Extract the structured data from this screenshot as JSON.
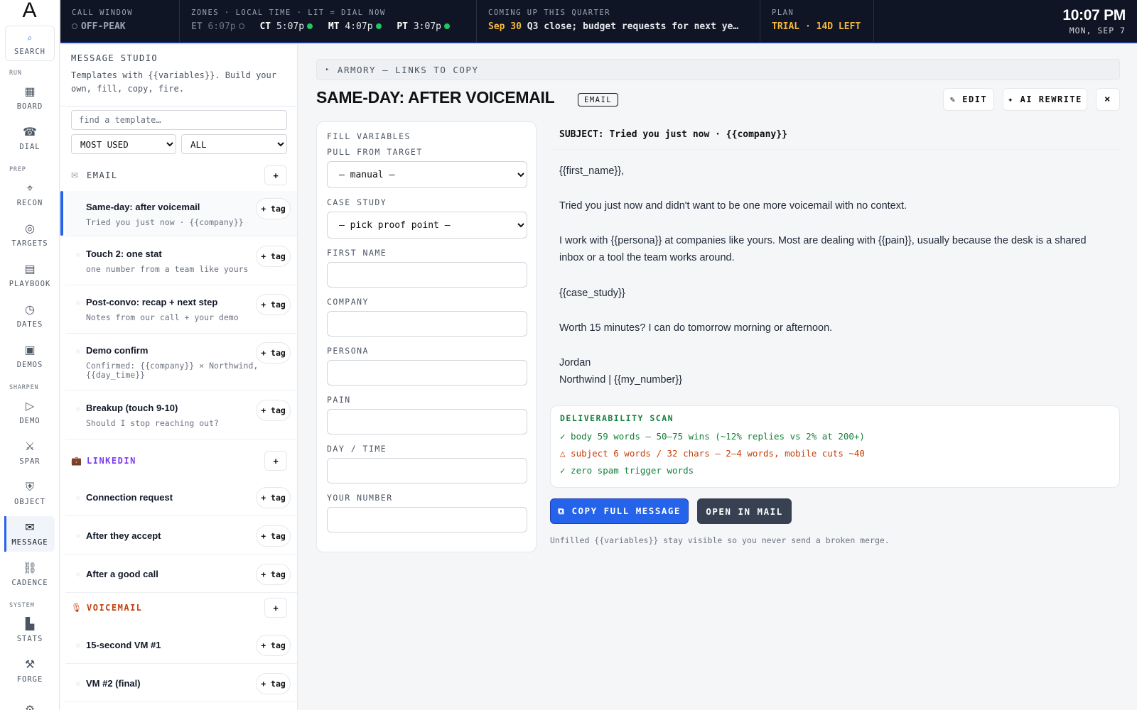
{
  "rail": {
    "logo": "A",
    "search": {
      "icon": "⌕",
      "label": "SEARCH"
    },
    "sections": {
      "run": "RUN",
      "prep": "PREP",
      "sharpen": "SHARPEN",
      "system": "SYSTEM"
    },
    "items": [
      {
        "icon": "▦",
        "label": "BOARD"
      },
      {
        "icon": "☎",
        "label": "DIAL"
      },
      {
        "icon": "⌖",
        "label": "RECON"
      },
      {
        "icon": "◎",
        "label": "TARGETS"
      },
      {
        "icon": "▤",
        "label": "PLAYBOOK"
      },
      {
        "icon": "◷",
        "label": "DATES"
      },
      {
        "icon": "▣",
        "label": "DEMOS"
      },
      {
        "icon": "▷",
        "label": "DEMO"
      },
      {
        "icon": "⚔",
        "label": "SPAR"
      },
      {
        "icon": "⛨",
        "label": "OBJECT"
      },
      {
        "icon": "✉",
        "label": "MESSAGE"
      },
      {
        "icon": "⛓",
        "label": "CADENCE"
      },
      {
        "icon": "▙",
        "label": "STATS"
      },
      {
        "icon": "⚒",
        "label": "FORGE"
      },
      {
        "icon": "⚙",
        "label": ""
      }
    ]
  },
  "topbar": {
    "call_window": {
      "label": "CALL WINDOW",
      "value": "OFF-PEAK"
    },
    "zones": {
      "label": "ZONES · LOCAL TIME · LIT = DIAL NOW",
      "items": [
        {
          "zone": "ET",
          "time": "6:07p",
          "lit": false
        },
        {
          "zone": "CT",
          "time": "5:07p",
          "lit": true
        },
        {
          "zone": "MT",
          "time": "4:07p",
          "lit": true
        },
        {
          "zone": "PT",
          "time": "3:07p",
          "lit": true
        }
      ]
    },
    "quarter": {
      "label": "COMING UP THIS QUARTER",
      "date": "Sep 30",
      "text": "Q3 close; budget requests for next ye…"
    },
    "plan": {
      "label": "PLAN",
      "value": "TRIAL · 14D LEFT"
    },
    "clock": {
      "time": "10:07 PM",
      "date": "MON, SEP 7"
    }
  },
  "studio": {
    "title": "MESSAGE STUDIO",
    "desc_line1": "Templates with {{variables}}. Build your",
    "desc_line2": "own, fill, copy, fire.",
    "search_placeholder": "find a template…",
    "sort_value": "MOST USED",
    "filter_value": "ALL",
    "add_label": "+",
    "tag_label": "+ tag",
    "categories": {
      "email": {
        "icon": "✉",
        "name": "EMAIL",
        "color": "#374151"
      },
      "linkedin": {
        "icon": "💼",
        "name": "LINKEDIN",
        "color": "#7c3aed"
      },
      "voicemail": {
        "icon": "🎙",
        "name": "VOICEMAIL",
        "color": "#c2410c"
      }
    },
    "email_templates": [
      {
        "name": "Same-day: after voicemail",
        "sub": "Tried you just now · {{company}}"
      },
      {
        "name": "Touch 2: one stat",
        "sub": "one number from a team like yours"
      },
      {
        "name": "Post-convo: recap + next step",
        "sub": "Notes from our call + your demo"
      },
      {
        "name": "Demo confirm",
        "sub": "Confirmed: {{company}} × Northwind,",
        "sub2": "{{day_time}}"
      },
      {
        "name": "Breakup (touch 9-10)",
        "sub": "Should I stop reaching out?"
      }
    ],
    "linkedin_templates": [
      {
        "name": "Connection request"
      },
      {
        "name": "After they accept"
      },
      {
        "name": "After a good call"
      }
    ],
    "voicemail_templates": [
      {
        "name": "15-second VM #1"
      },
      {
        "name": "VM #2 (final)"
      }
    ]
  },
  "main": {
    "armory": {
      "caret": "▸",
      "label": "ARMORY — LINKS TO COPY"
    },
    "title": "SAME-DAY: AFTER VOICEMAIL",
    "badge": "EMAIL",
    "edit_label": "✎ EDIT",
    "ai_label": "✦ AI REWRITE",
    "close_label": "×",
    "vars": {
      "heading": "FILL VARIABLES",
      "pull_label": "PULL FROM TARGET",
      "pull_value": "— manual —",
      "case_label": "CASE STUDY",
      "case_value": "— pick proof point —",
      "fields": [
        {
          "label": "FIRST NAME",
          "value": ""
        },
        {
          "label": "COMPANY",
          "value": ""
        },
        {
          "label": "PERSONA",
          "value": ""
        },
        {
          "label": "PAIN",
          "value": ""
        },
        {
          "label": "DAY / TIME",
          "value": ""
        },
        {
          "label": "YOUR NUMBER",
          "value": ""
        }
      ]
    },
    "preview": {
      "subject": "SUBJECT: Tried you just now · {{company}}",
      "lines": [
        "{{first_name}},",
        "Tried you just now and didn't want to be one more voicemail with no context.",
        "I work with {{persona}} at companies like yours. Most are dealing with {{pain}}, usually because the desk is a shared",
        "inbox or a tool the team works around.",
        "{{case_study}}",
        "Worth 15 minutes? I can do tomorrow morning or afternoon.",
        "Jordan",
        "Northwind | {{my_number}}"
      ]
    },
    "scan": {
      "title": "DELIVERABILITY SCAN",
      "items": [
        {
          "status": "ok",
          "text": "✓ body 59 words — 50–75 wins (~12% replies vs 2% at 200+)"
        },
        {
          "status": "warn",
          "text": "△ subject 6 words / 32 chars — 2–4 words, mobile cuts ~40"
        },
        {
          "status": "ok",
          "text": "✓ zero spam trigger words"
        }
      ]
    },
    "copy_label": "⧉ COPY FULL MESSAGE",
    "mail_label": "OPEN IN MAIL",
    "hint": "Unfilled {{variables}} stay visible so you never send a broken merge."
  },
  "colors": {
    "accent": "#2563eb",
    "topbar_bg": "#0f1524",
    "amber": "#f5b83d",
    "lit": "#22c55e"
  }
}
